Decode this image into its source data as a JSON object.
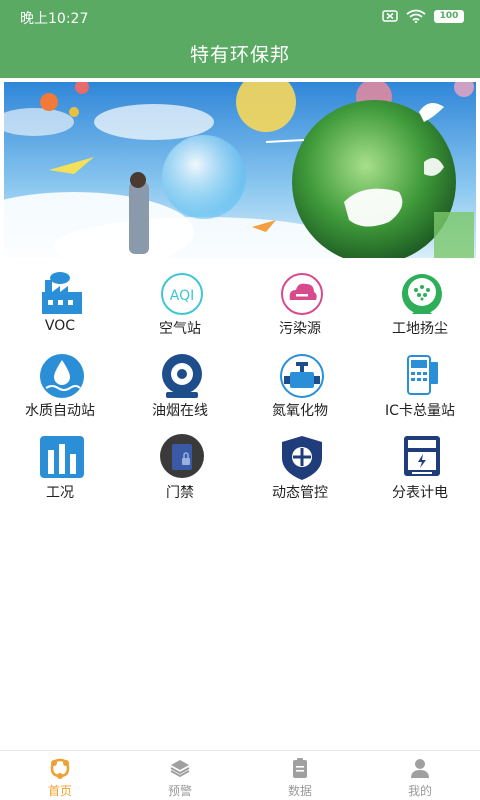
{
  "status": {
    "time": "晚上10:27",
    "battery": "100"
  },
  "header": {
    "title": "特有环保邦"
  },
  "grid": [
    {
      "label": "VOC",
      "icon": "factory-icon"
    },
    {
      "label": "空气站",
      "icon": "aqi-icon"
    },
    {
      "label": "污染源",
      "icon": "pollution-cloud-icon"
    },
    {
      "label": "工地扬尘",
      "icon": "dust-icon"
    },
    {
      "label": "水质自动站",
      "icon": "water-drop-icon"
    },
    {
      "label": "油烟在线",
      "icon": "fume-icon"
    },
    {
      "label": "氮氧化物",
      "icon": "valve-icon"
    },
    {
      "label": "IC卡总量站",
      "icon": "card-reader-icon"
    },
    {
      "label": "工况",
      "icon": "bar-chart-icon"
    },
    {
      "label": "门禁",
      "icon": "door-lock-icon"
    },
    {
      "label": "动态管控",
      "icon": "shield-icon"
    },
    {
      "label": "分表计电",
      "icon": "meter-icon"
    }
  ],
  "tabs": [
    {
      "label": "首页",
      "active": true
    },
    {
      "label": "预警",
      "active": false
    },
    {
      "label": "数据",
      "active": false
    },
    {
      "label": "我的",
      "active": false
    }
  ],
  "colors": {
    "header": "#5aaa64",
    "active_tab": "#f0a030",
    "inactive_tab": "#9a9a9a"
  }
}
